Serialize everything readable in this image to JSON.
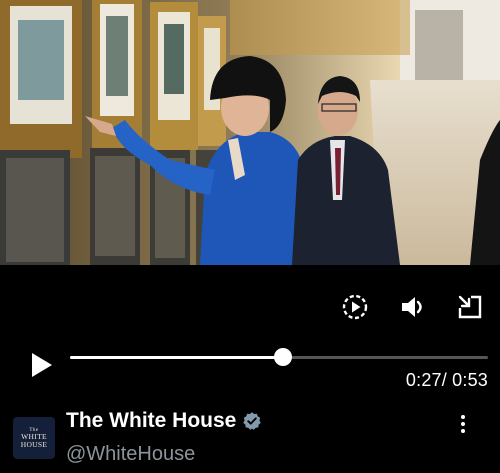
{
  "video": {
    "description_icon": "video-frame"
  },
  "controls": {
    "autoplay_icon": "autoplay-icon",
    "volume_icon": "volume-icon",
    "fullscreen_icon": "fullscreen-exit-icon",
    "play_icon": "play-icon",
    "progress_fraction": 0.51,
    "current_time": "0:27",
    "duration": "0:53",
    "time_display": "0:27/ 0:53"
  },
  "account": {
    "avatar_line1": "The",
    "avatar_line2": "WHITE",
    "avatar_line3": "HOUSE",
    "name": "The White House",
    "handle": "@WhiteHouse",
    "verified_icon": "verified-badge-icon",
    "more_icon": "more-vertical-icon"
  },
  "colors": {
    "background": "#000000",
    "accent": "#ffffff",
    "handle": "#8b949b",
    "badge": "#829aab"
  }
}
